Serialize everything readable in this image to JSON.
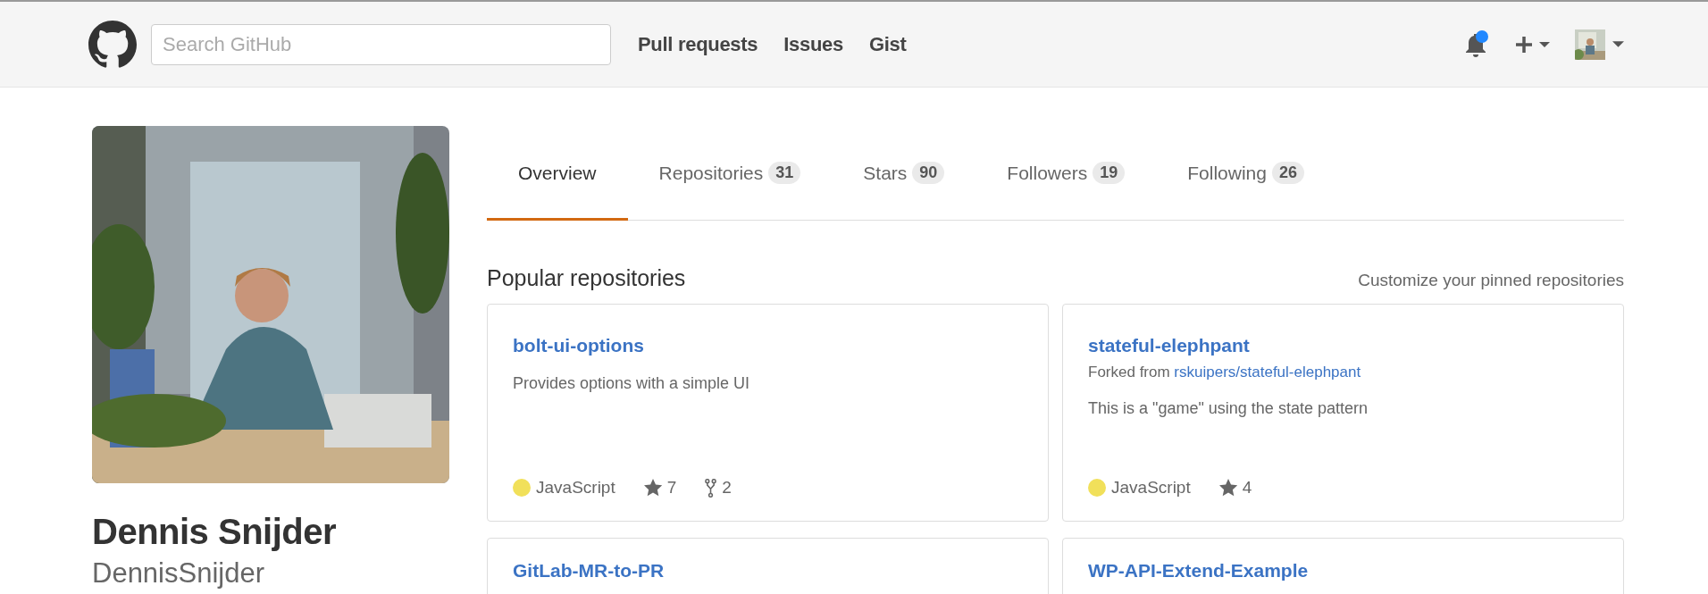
{
  "header": {
    "search": {
      "placeholder": "Search GitHub"
    },
    "nav": [
      "Pull requests",
      "Issues",
      "Gist"
    ],
    "notifications": {
      "unread": true
    }
  },
  "profile": {
    "name": "Dennis Snijder",
    "username": "DennisSnijder"
  },
  "tabs": [
    {
      "label": "Overview",
      "selected": true
    },
    {
      "label": "Repositories",
      "count": "31",
      "selected": false
    },
    {
      "label": "Stars",
      "count": "90",
      "selected": false
    },
    {
      "label": "Followers",
      "count": "19",
      "selected": false
    },
    {
      "label": "Following",
      "count": "26",
      "selected": false
    }
  ],
  "pinned": {
    "title": "Popular repositories",
    "customize_link": "Customize your pinned repositories",
    "repos": [
      {
        "name": "bolt-ui-options",
        "description": "Provides options with a simple UI",
        "language": "JavaScript",
        "color": "#f1e05a",
        "stars": "7",
        "forks": "2"
      },
      {
        "name": "stateful-elephpant",
        "forked_prefix": "Forked from",
        "forked_from": "rskuipers/stateful-elephpant",
        "description": "This is a \"game\" using the state pattern",
        "language": "JavaScript",
        "color": "#f1e05a",
        "stars": "4"
      },
      {
        "name": "GitLab-MR-to-PR"
      },
      {
        "name": "WP-API-Extend-Example"
      }
    ]
  }
}
